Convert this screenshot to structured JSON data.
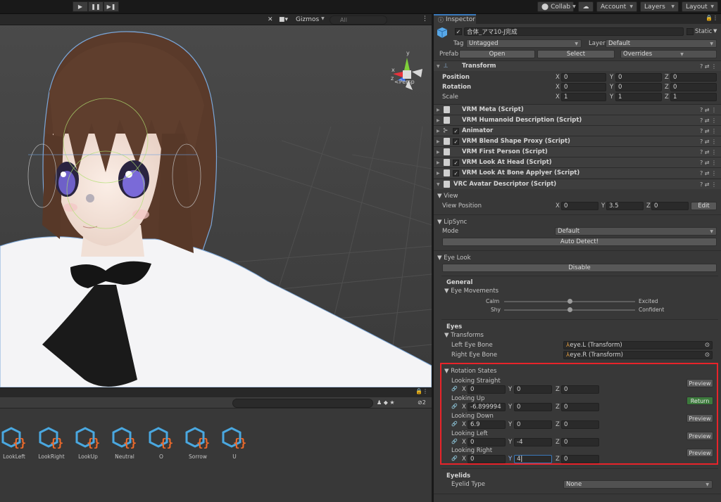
{
  "toolbar": {
    "play_label": "▶",
    "pause_label": "❚❚",
    "step_label": "▶❚",
    "collab_label": "Collab",
    "account_label": "Account",
    "layers_label": "Layers",
    "layout_label": "Layout"
  },
  "scene": {
    "gizmos_label": "Gizmos",
    "search_placeholder": "All",
    "persp_label": "Persp",
    "axis_x": "x",
    "axis_y": "y",
    "axis_z": "z"
  },
  "project": {
    "count_badge": "2",
    "assets": [
      "LookLeft",
      "LookRight",
      "LookUp",
      "Neutral",
      "O",
      "Sorrow",
      "U"
    ]
  },
  "inspector": {
    "tab_label": "Inspector",
    "object_name": "合体_アマ10-J完成",
    "static_label": "Static",
    "tag_label": "Tag",
    "tag_value": "Untagged",
    "layer_label": "Layer",
    "layer_value": "Default",
    "prefab_label": "Prefab",
    "open_label": "Open",
    "select_label": "Select",
    "overrides_label": "Overrides",
    "transform": {
      "title": "Transform",
      "position_label": "Position",
      "rotation_label": "Rotation",
      "scale_label": "Scale",
      "position": {
        "x": "0",
        "y": "0",
        "z": "0"
      },
      "rotation": {
        "x": "0",
        "y": "0",
        "z": "0"
      },
      "scale": {
        "x": "1",
        "y": "1",
        "z": "1"
      }
    },
    "components": [
      {
        "name": "VRM Meta (Script)",
        "checkbox": false
      },
      {
        "name": "VRM Humanoid Description (Script)",
        "checkbox": false
      },
      {
        "name": "Animator",
        "checkbox": true
      },
      {
        "name": "VRM Blend Shape Proxy (Script)",
        "checkbox": true
      },
      {
        "name": "VRM First Person (Script)",
        "checkbox": false
      },
      {
        "name": "VRM Look At Head (Script)",
        "checkbox": true
      },
      {
        "name": "VRM Look At Bone Applyer (Script)",
        "checkbox": true
      },
      {
        "name": "VRC Avatar Descriptor (Script)",
        "checkbox": false
      }
    ],
    "descriptor": {
      "view_label": "View",
      "view_position_label": "View Position",
      "view_position": {
        "x": "0",
        "y": "3.5",
        "z": "0"
      },
      "edit_label": "Edit",
      "lipsync_label": "LipSync",
      "mode_label": "Mode",
      "mode_value": "Default",
      "auto_detect_label": "Auto Detect!",
      "eye_look_label": "Eye Look",
      "disable_label": "Disable",
      "general_label": "General",
      "eye_movements_label": "Eye Movements",
      "calm_label": "Calm",
      "excited_label": "Excited",
      "shy_label": "Shy",
      "confident_label": "Confident",
      "calm_excited_value": 0.5,
      "shy_confident_value": 0.5,
      "eyes_label": "Eyes",
      "transforms_label": "Transforms",
      "left_eye_label": "Left Eye Bone",
      "left_eye_value": "eye.L (Transform)",
      "right_eye_label": "Right Eye Bone",
      "right_eye_value": "eye.R (Transform)",
      "rotation_states_label": "Rotation States",
      "states": [
        {
          "name": "Looking Straight",
          "x": "0",
          "y": "0",
          "z": "0",
          "button": "Preview",
          "active": false
        },
        {
          "name": "Looking Up",
          "x": "-6.899994",
          "y": "0",
          "z": "0",
          "button": "Return",
          "active": true
        },
        {
          "name": "Looking Down",
          "x": "6.9",
          "y": "0",
          "z": "0",
          "button": "Preview",
          "active": false
        },
        {
          "name": "Looking Left",
          "x": "0",
          "y": "-4",
          "z": "0",
          "button": "Preview",
          "active": false
        },
        {
          "name": "Looking Right",
          "x": "0",
          "y": "4",
          "z": "0",
          "button": "Preview",
          "active": false
        }
      ],
      "eyelids_label": "Eyelids",
      "eyelid_type_label": "Eyelid Type",
      "eyelid_type_value": "None"
    }
  }
}
